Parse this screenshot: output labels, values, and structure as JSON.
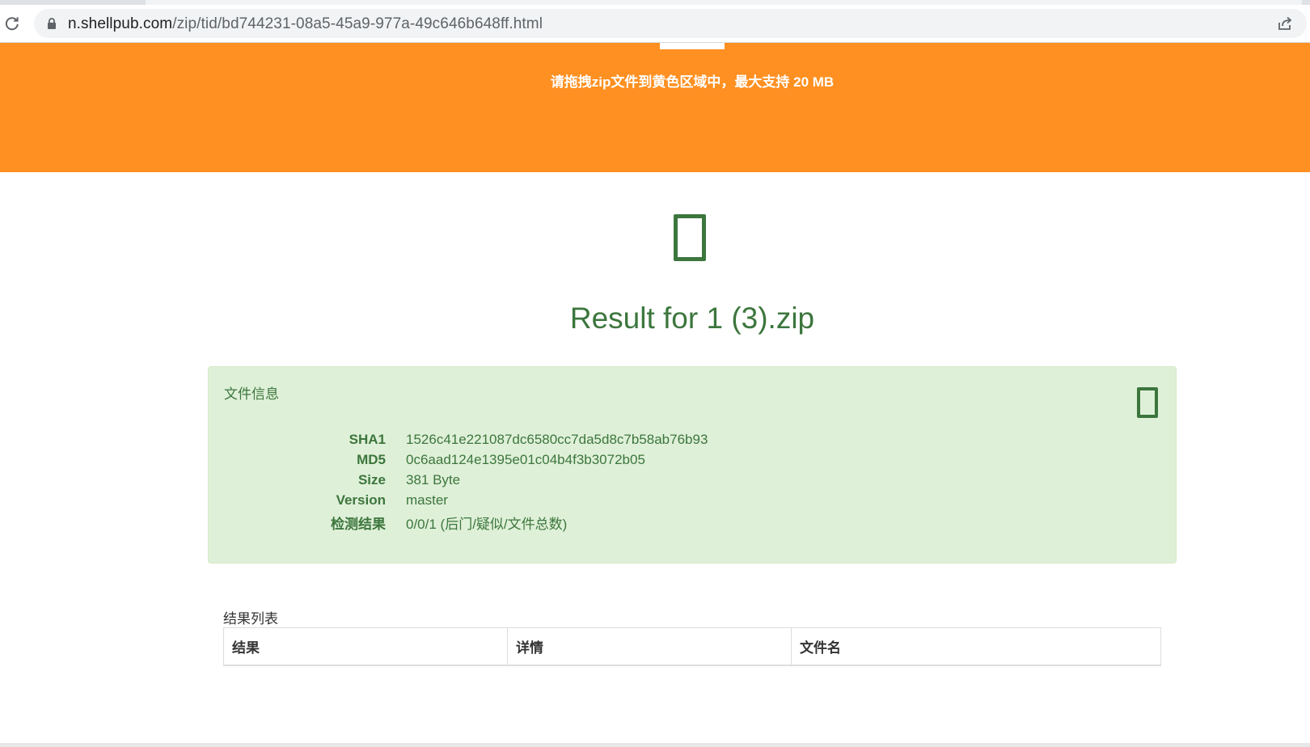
{
  "browser": {
    "url_host": "n.shellpub.com",
    "url_path": "/zip/tid/bd744231-08a5-45a9-977a-49c646b648ff.html",
    "icons": {
      "reload": "reload-icon",
      "lock": "lock-icon",
      "share": "share-icon"
    }
  },
  "banner": {
    "instruction": "请拖拽zip文件到黄色区域中，最大支持 20 MB",
    "color": "#ff9021"
  },
  "result": {
    "title": "Result for 1 (3).zip",
    "status_icon": "file-icon",
    "accent_color": "#3c763d"
  },
  "file_info": {
    "title": "文件信息",
    "icon": "file-icon",
    "background": "#dff0d8",
    "rows": [
      {
        "key": "SHA1",
        "value": "1526c41e221087dc6580cc7da5d8c7b58ab76b93"
      },
      {
        "key": "MD5",
        "value": "0c6aad124e1395e01c04b4f3b3072b05"
      },
      {
        "key": "Size",
        "value": "381 Byte"
      },
      {
        "key": "Version",
        "value": "master"
      },
      {
        "key": "检测结果",
        "value": "0/0/1 (后门/疑似/文件总数)"
      }
    ]
  },
  "results_list": {
    "caption": "结果列表",
    "columns": [
      "结果",
      "详情",
      "文件名"
    ]
  }
}
